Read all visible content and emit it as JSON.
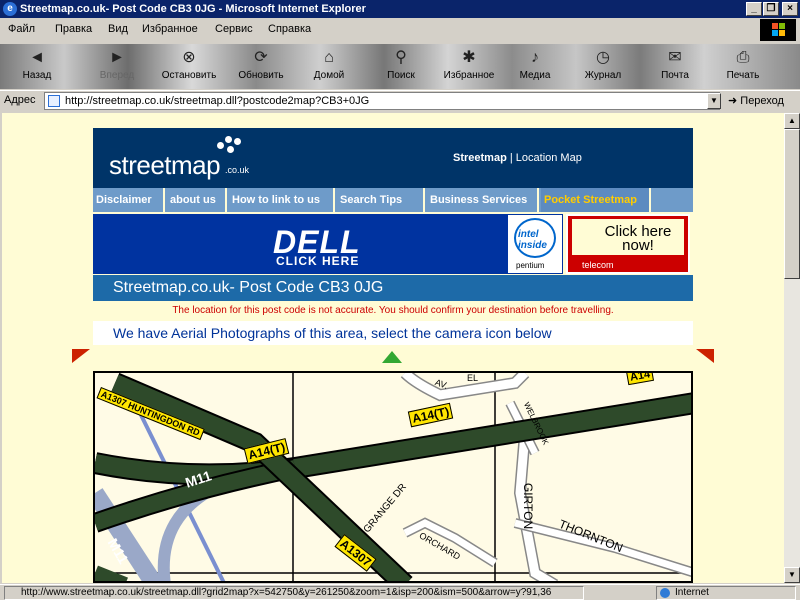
{
  "window": {
    "title": "Streetmap.co.uk- Post Code CB3 0JG - Microsoft Internet Explorer",
    "controls": [
      "_",
      "❐",
      "×"
    ]
  },
  "menu": [
    "Файл",
    "Правка",
    "Вид",
    "Избранное",
    "Сервис",
    "Справка"
  ],
  "toolbar": {
    "back": "Назад",
    "forward": "Вперед",
    "stop": "Остановить",
    "refresh": "Обновить",
    "home": "Домой",
    "search": "Поиск",
    "favorites": "Избранное",
    "media": "Медиа",
    "history": "Журнал",
    "mail": "Почта",
    "print": "Печать"
  },
  "address": {
    "label": "Адрес",
    "url": "http://streetmap.co.uk/streetmap.dll?postcode2map?CB3+0JG",
    "go": "Переход"
  },
  "site": {
    "logo": "streetmap",
    "logo_suffix": ".co.uk",
    "header_link_active": "Streetmap",
    "header_link_sep": " | ",
    "header_link_other": "Location Map",
    "nav": [
      "Disclaimer",
      "about us",
      "How to link to us",
      "Search Tips",
      "Business Services",
      "Pocket Streetmap"
    ],
    "ads": {
      "dell_logo": "DELL",
      "dell_cta": "CLICK HERE",
      "intel_text": "intel inside",
      "intel_sub": "pentium",
      "click_here": "Click here now!",
      "telecom": "telecom"
    },
    "page_title": "Streetmap.co.uk- Post Code CB3 0JG",
    "warning": "The location for this post code is not accurate. You should confirm your destination before travelling.",
    "aerial": "We have Aerial Photographs of this area, select the camera icon below"
  },
  "map": {
    "roads": {
      "a1307_huntingdon": "A1307 HUNTINGDON RD",
      "a14_top": "A14",
      "a14_right": "A14(T)",
      "a14_center": "A14(T)",
      "m11_center": "M11",
      "m11_left": "M11",
      "grange": "GRANGE DR",
      "a1307_bottom": "A1307",
      "girton": "GIRTON",
      "thornton": "THORNTON",
      "orchard": "ORCHARD",
      "welbrook": "WELBROOK",
      "av": "AV.",
      "el": "EL"
    }
  },
  "status": {
    "url": "http://www.streetmap.co.uk/streetmap.dll?grid2map?x=542750&y=261250&zoom=1&isp=200&ism=500&arrow=y?91,36",
    "zone": "Internet"
  },
  "colors": {
    "header_navy": "#003468",
    "nav_blue": "#6e9bc9",
    "pocket_yellow": "#ffcc00",
    "page_bg": "#fffcd5",
    "motorway": "#2e4a2a",
    "a_road_yellow": "#ffe600"
  }
}
